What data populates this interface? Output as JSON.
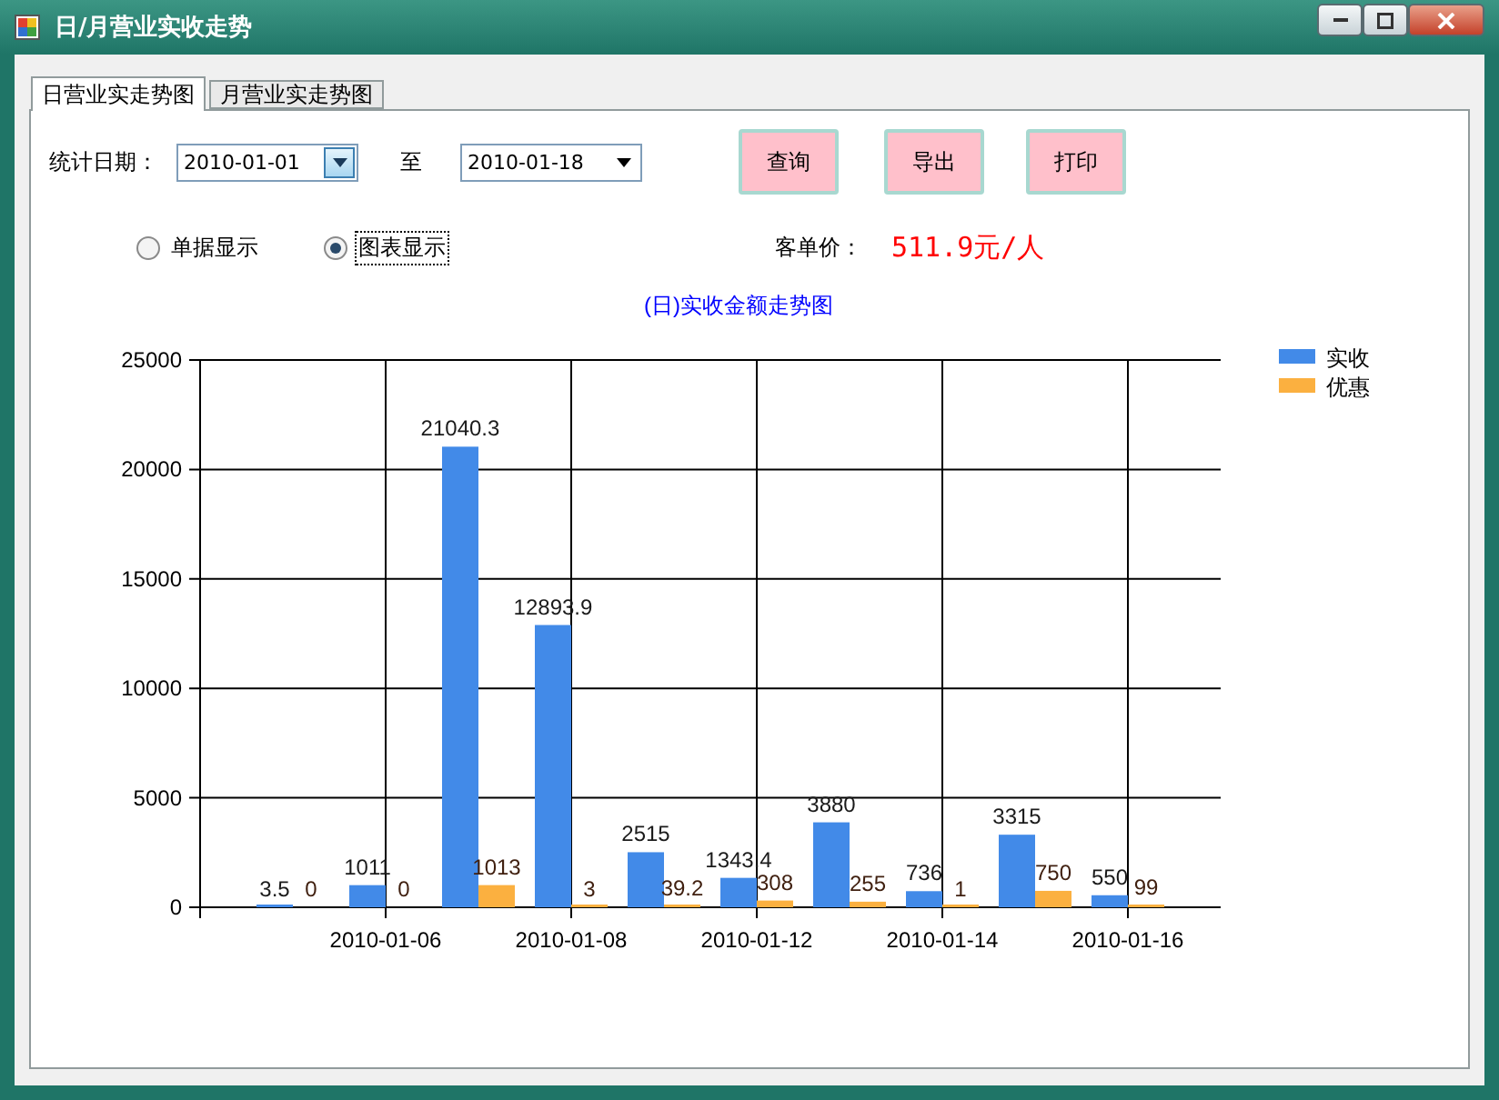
{
  "window": {
    "title": "日/月营业实收走势"
  },
  "tabs": [
    {
      "label": "日营业实走势图",
      "selected": true
    },
    {
      "label": "月营业实走势图",
      "selected": false
    }
  ],
  "filter": {
    "label": "统计日期：",
    "start_date": "2010-01-01",
    "separator": "至",
    "end_date": "2010-01-18"
  },
  "buttons": [
    "查询",
    "导出",
    "打印"
  ],
  "display_modes": [
    {
      "label": "单据显示",
      "selected": false
    },
    {
      "label": "图表显示",
      "selected": true
    }
  ],
  "avg_price": {
    "label": "客单价：",
    "value": "511.9元/人"
  },
  "chart_data": {
    "type": "bar",
    "title": "(日)实收金额走势图",
    "categories": [
      null,
      "2010-01-06",
      null,
      "2010-01-08",
      null,
      "2010-01-12",
      null,
      "2010-01-14",
      null,
      "2010-01-16"
    ],
    "grid": true,
    "legend": "right",
    "ylim": [
      0,
      25000
    ],
    "yticks": [
      0,
      5000,
      10000,
      15000,
      20000,
      25000
    ],
    "data_labels": true,
    "series": [
      {
        "name": "实收",
        "color": "#428ae8",
        "values": [
          3.5,
          1011,
          21040.3,
          12893.9,
          2515,
          1343.4,
          3880,
          736,
          3315,
          550
        ]
      },
      {
        "name": "优惠",
        "color": "#fbb040",
        "values": [
          0,
          0,
          1013,
          3,
          39.2,
          308,
          255,
          1,
          750,
          99
        ]
      }
    ]
  }
}
